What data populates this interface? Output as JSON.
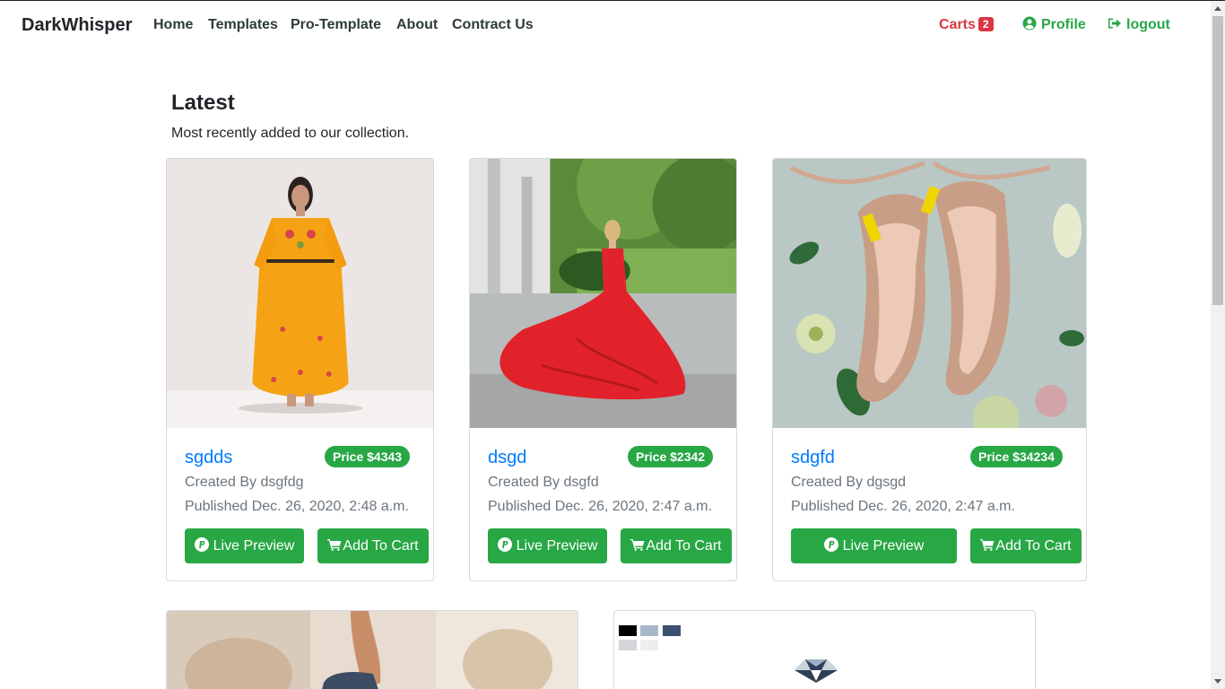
{
  "navbar": {
    "brand": "DarkWhisper",
    "links": [
      "Home",
      "Templates",
      "Pro-Template",
      "About",
      "Contract Us"
    ],
    "carts_label": "Carts",
    "cart_count": "2",
    "profile_label": "Profile",
    "logout_label": "logout"
  },
  "section": {
    "title": "Latest",
    "subtitle": "Most recently added to our collection."
  },
  "cards": [
    {
      "name": "sgdds",
      "price": "Price $4343",
      "created_by": "Created By dsgfdg",
      "published": "Published Dec. 26, 2020, 2:48 a.m.",
      "preview_label": "Live Preview",
      "cart_label": "Add To Cart",
      "image": "woman-orange-dress"
    },
    {
      "name": "dsgd",
      "price": "Price $2342",
      "created_by": "Created By dsgfd",
      "published": "Published Dec. 26, 2020, 2:47 a.m.",
      "preview_label": "Live Preview",
      "cart_label": "Add To Cart",
      "image": "woman-red-dress"
    },
    {
      "name": "sdgfd",
      "price": "Price $34234",
      "created_by": "Created By dgsgd",
      "published": "Published Dec. 26, 2020, 2:47 a.m.",
      "preview_label": "Live Preview",
      "cart_label": "Add To Cart",
      "image": "gold-heels-flowers"
    }
  ],
  "colors": {
    "primary_link": "#007bff",
    "success": "#28a745",
    "danger": "#dc3545"
  },
  "icons": {
    "profile": "user-circle-icon",
    "logout": "sign-out-icon",
    "preview": "paypal-circle-icon",
    "cart": "shopping-cart-icon"
  }
}
